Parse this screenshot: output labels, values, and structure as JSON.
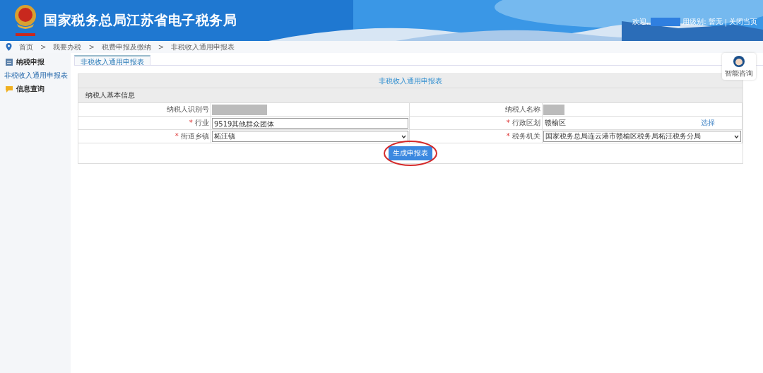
{
  "header": {
    "title": "国家税务总局江苏省电子税务局",
    "welcome": "欢迎,",
    "user_level": "用级别:",
    "level_value": "暂无",
    "separator": "|",
    "close_link": "关闭当页"
  },
  "breadcrumb": [
    "首页",
    "我要办税",
    "税费申报及缴纳",
    "非税收入通用申报表"
  ],
  "breadcrumb_separator": ">",
  "sidebar": {
    "items": [
      {
        "label": "纳税申报",
        "children": [
          {
            "label": "非税收入通用申报表",
            "selected": true
          }
        ]
      },
      {
        "label": "信息查询"
      }
    ]
  },
  "tabs": [
    {
      "label": "非税收入通用申报表",
      "selected": true
    }
  ],
  "form": {
    "title": "非税收入通用申报表",
    "section": "纳税人基本信息",
    "rows": [
      {
        "left": {
          "label": "纳税人识别号",
          "required": false,
          "kind": "redacted"
        },
        "right": {
          "label": "纳税人名称",
          "required": false,
          "kind": "redacted"
        }
      },
      {
        "left": {
          "label": "行业",
          "required": true,
          "kind": "input",
          "value": "9519其他群众团体"
        },
        "right": {
          "label": "行政区划",
          "required": true,
          "kind": "text",
          "value": "赣榆区",
          "link": "选择"
        }
      },
      {
        "left": {
          "label": "街道乡镇",
          "required": true,
          "kind": "select",
          "value": "柘汪镇"
        },
        "right": {
          "label": "税务机关",
          "required": true,
          "kind": "select",
          "value": "国家税务总局连云港市赣榆区税务局柘汪税务分局"
        }
      }
    ],
    "required_mark": "*",
    "submit_button": "生成申报表",
    "submit_highlighted": true
  },
  "help": {
    "label": "智能咨询"
  }
}
